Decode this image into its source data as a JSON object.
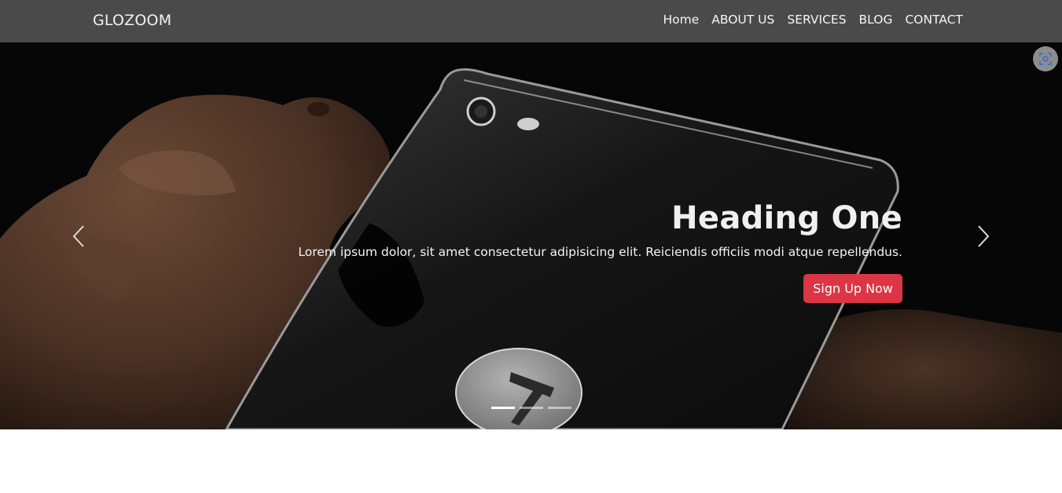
{
  "navbar": {
    "brand": "GLOZOOM",
    "links": [
      "Home",
      "ABOUT US",
      "SERVICES",
      "BLOG",
      "CONTACT"
    ]
  },
  "carousel": {
    "slide": {
      "heading": "Heading One",
      "text": "Lorem ipsum dolor, sit amet consectetur adipisicing elit. Reiciendis officiis modi atque repellendus.",
      "button_label": "Sign Up Now"
    },
    "indicators": [
      true,
      false,
      false
    ],
    "prev_icon": "chevron-left-icon",
    "next_icon": "chevron-right-icon"
  },
  "overlay": {
    "fullscreen_icon": "fullscreen-icon"
  },
  "colors": {
    "navbar_bg": "#4a4a4a",
    "cta_bg": "#dc3545"
  }
}
